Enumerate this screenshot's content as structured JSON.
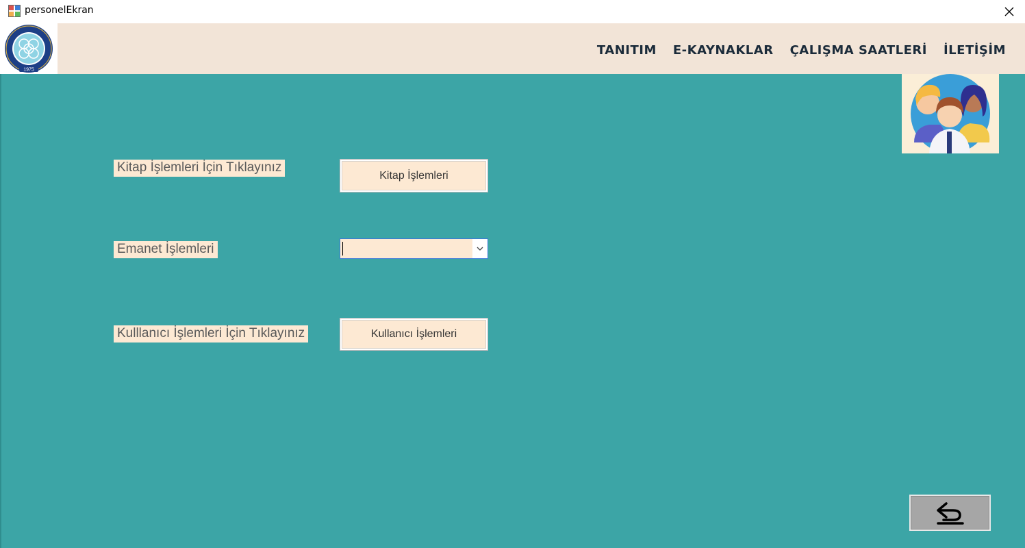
{
  "window": {
    "title": "personelEkran",
    "close_icon": "close-icon"
  },
  "header": {
    "logo_icon": "university-seal-icon",
    "logo_year": "1975",
    "nav": [
      {
        "label": "TANITIM"
      },
      {
        "label": "E-KAYNAKLAR"
      },
      {
        "label": "ÇALIŞMA SAATLERİ"
      },
      {
        "label": "İLETİŞİM"
      }
    ]
  },
  "main": {
    "background": "#3ca5a6",
    "accent": "#fde9d3",
    "avatar_icon": "staff-group-icon",
    "rows": {
      "kitap": {
        "label": "Kitap İşlemleri İçin Tıklayınız",
        "button": "Kitap İşlemleri"
      },
      "emanet": {
        "label": "Emanet İşlemleri",
        "selected_value": ""
      },
      "kullanici": {
        "label": "Kulllanıcı İşlemleri İçin Tıklayınız",
        "button": "Kullanıcı İşlemleri"
      }
    },
    "back_icon": "back-arrow-icon"
  }
}
